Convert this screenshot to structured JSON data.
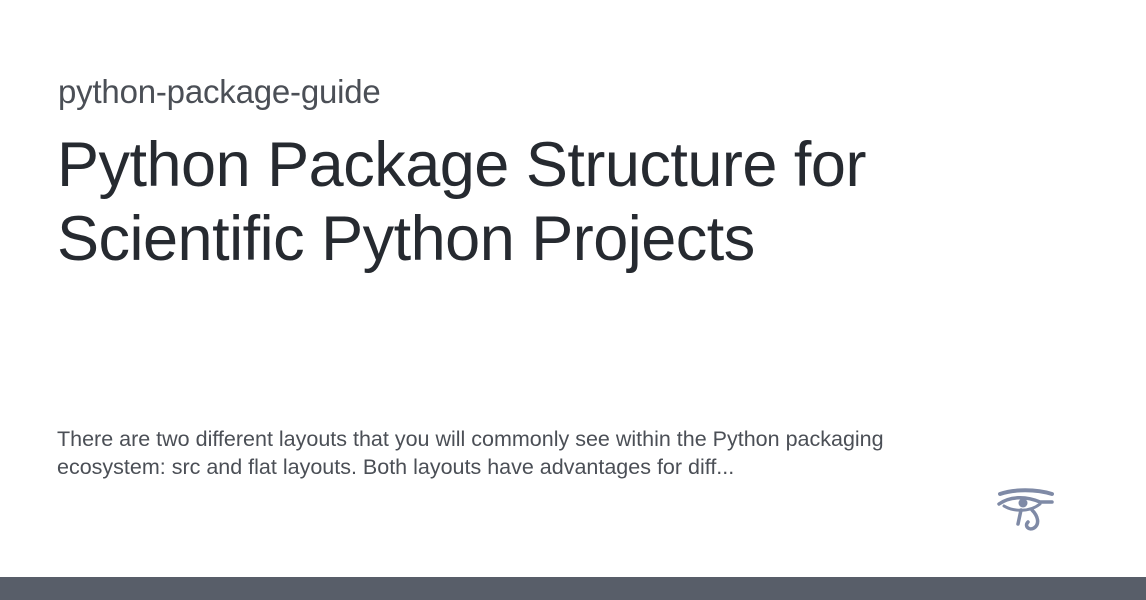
{
  "site": {
    "name": "python-package-guide"
  },
  "page": {
    "title": "Python Package Structure for Scientific Python Projects",
    "description": "There are two different layouts that you will commonly see within the Python packaging ecosystem: src and flat layouts. Both layouts have advantages for diff..."
  },
  "logo": {
    "icon": "eye-of-horus-icon",
    "color": "#7f8aa6"
  },
  "colors": {
    "background": "#ffffff",
    "title_text": "#262a30",
    "secondary_text": "#4b4f56",
    "bottom_bar": "#585e69"
  }
}
